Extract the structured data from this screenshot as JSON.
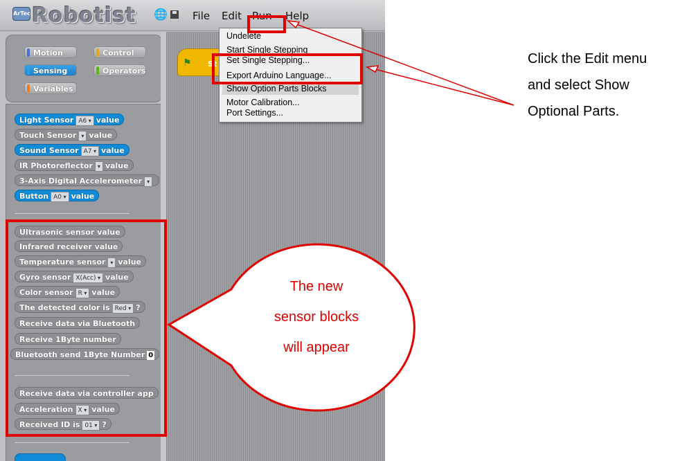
{
  "app": {
    "name": "Robotist",
    "logo_badge": "ArTec",
    "menus": [
      "File",
      "Edit",
      "Run",
      "Help"
    ]
  },
  "categories": [
    {
      "label": "Motion",
      "color": "#4a6cd4"
    },
    {
      "label": "Control",
      "color": "#e1a91a"
    },
    {
      "label": "Sensing",
      "color": "#0f8bd8",
      "selected": true
    },
    {
      "label": "Operators",
      "color": "#5cb712"
    },
    {
      "label": "Variables",
      "color": "#ee7d16"
    }
  ],
  "blocks": {
    "light_sensor": {
      "label": "Light Sensor",
      "port": "A6",
      "suffix": "value"
    },
    "touch_sensor": {
      "label": "Touch Sensor",
      "suffix": "value"
    },
    "sound_sensor": {
      "label": "Sound Sensor",
      "port": "A7",
      "suffix": "value"
    },
    "ir_photoreflector": {
      "label": "IR Photoreflector",
      "suffix": "value"
    },
    "accelerometer": {
      "label": "3-Axis Digital Accelerometer"
    },
    "button": {
      "label": "Button",
      "port": "A0",
      "suffix": "value"
    },
    "ultrasonic": {
      "label": "Ultrasonic sensor value"
    },
    "infrared": {
      "label": "Infrared receiver value"
    },
    "temperature": {
      "label": "Temperature sensor",
      "suffix": "value"
    },
    "gyro": {
      "label": "Gyro sensor",
      "axis": "X(Acc)",
      "suffix": "value"
    },
    "color": {
      "label": "Color sensor",
      "channel": "R",
      "suffix": "value"
    },
    "detected_color": {
      "label": "The detected color is",
      "value": "Red",
      "suffix": "?"
    },
    "receive_bt": {
      "label": "Receive data via Bluetooth"
    },
    "receive_byte": {
      "label": "Receive 1Byte number"
    },
    "bt_send": {
      "label": "Bluetooth send 1Byte Number",
      "value": "0"
    },
    "receive_controller": {
      "label": "Receive data via controller app"
    },
    "acceleration": {
      "label": "Acceleration",
      "axis": "X",
      "suffix": "value"
    },
    "received_id": {
      "label": "Received ID is",
      "value": "01",
      "suffix": "?"
    }
  },
  "script": {
    "hat_label": "St"
  },
  "run_menu": {
    "items": [
      "Undelete",
      "Start Single Stepping",
      "Set Single Stepping...",
      "Export Arduino Language...",
      "Show Option Parts Blocks",
      "Motor Calibration...",
      "Port Settings..."
    ]
  },
  "annotations": {
    "instruction": [
      "Click the Edit menu",
      "and select Show",
      "Optional Parts."
    ],
    "bubble": [
      "The new",
      "sensor blocks",
      "will appear"
    ],
    "accent_color": "#e00000"
  }
}
